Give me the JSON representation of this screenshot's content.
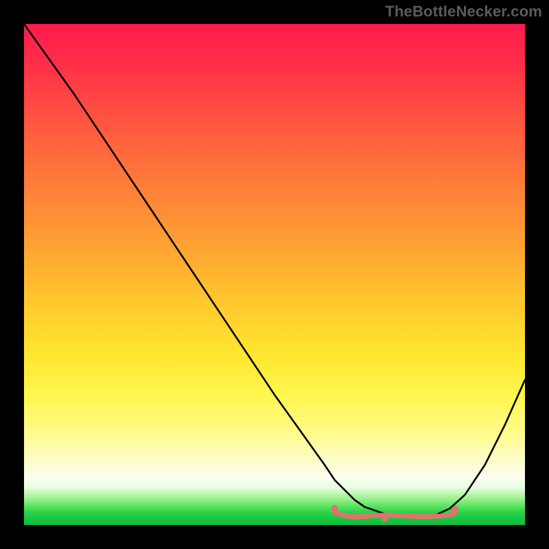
{
  "watermark": "TheBottleNecker.com",
  "colors": {
    "marker": "#e0736b",
    "curve": "#000000"
  },
  "chart_data": {
    "type": "line",
    "title": "",
    "xlabel": "",
    "ylabel": "",
    "xlim": [
      0,
      100
    ],
    "ylim": [
      0,
      100
    ],
    "x": [
      0,
      5,
      10,
      15,
      20,
      25,
      30,
      35,
      40,
      45,
      50,
      55,
      60,
      62,
      64,
      66,
      68,
      72,
      76,
      80,
      82,
      85,
      88,
      92,
      96,
      100
    ],
    "y": [
      100,
      93,
      86,
      78.5,
      71,
      63.5,
      56,
      48.5,
      41,
      33.5,
      26,
      19,
      12,
      9,
      7,
      5,
      3.6,
      2.2,
      1.5,
      1.5,
      1.9,
      3.3,
      6,
      12,
      20,
      29
    ],
    "trough_markers": {
      "x_start": 62,
      "x_end": 86,
      "y": 2,
      "left_dot": {
        "x": 62,
        "y": 3.3
      },
      "right_dot": {
        "x": 86,
        "y": 3.1
      },
      "mid_dot": {
        "x": 72,
        "y": 1.3
      }
    }
  }
}
